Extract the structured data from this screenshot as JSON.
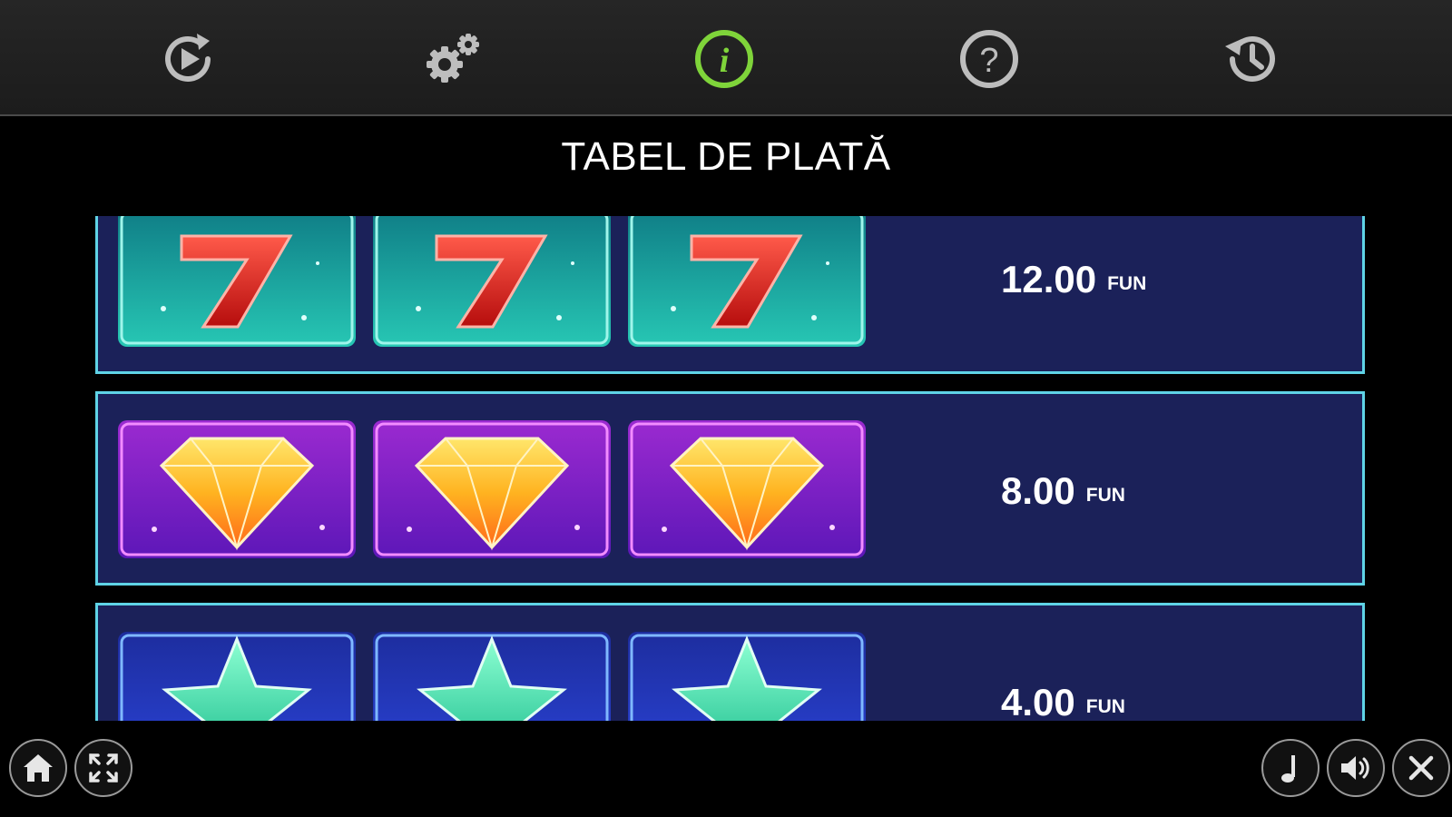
{
  "nav": {
    "items": [
      {
        "name": "autoplay",
        "icon": "autoplay-icon",
        "active": false
      },
      {
        "name": "settings",
        "icon": "gear-icon",
        "active": false
      },
      {
        "name": "info",
        "icon": "info-icon",
        "active": true
      },
      {
        "name": "help",
        "icon": "help-icon",
        "active": false
      },
      {
        "name": "history",
        "icon": "history-icon",
        "active": false
      }
    ],
    "active_color": "#7fd43a",
    "icon_color": "#bdbdbd"
  },
  "title": "TABEL DE PLATĂ",
  "paytable": [
    {
      "symbol": "seven",
      "symbol_icon": "red-seven-icon",
      "count": 3,
      "amount": "12.00",
      "currency": "FUN"
    },
    {
      "symbol": "diamond",
      "symbol_icon": "diamond-icon",
      "count": 3,
      "amount": "8.00",
      "currency": "FUN"
    },
    {
      "symbol": "star",
      "symbol_icon": "green-star-icon",
      "count": 3,
      "amount": "4.00",
      "currency": "FUN"
    }
  ],
  "colors": {
    "row_background": "#1b2159",
    "row_border": "#5fd3e6"
  },
  "footer": {
    "left": [
      {
        "icon": "home-icon"
      },
      {
        "icon": "fullscreen-icon"
      }
    ],
    "right": [
      {
        "icon": "music-icon"
      },
      {
        "icon": "sound-icon"
      },
      {
        "icon": "close-icon"
      }
    ]
  }
}
